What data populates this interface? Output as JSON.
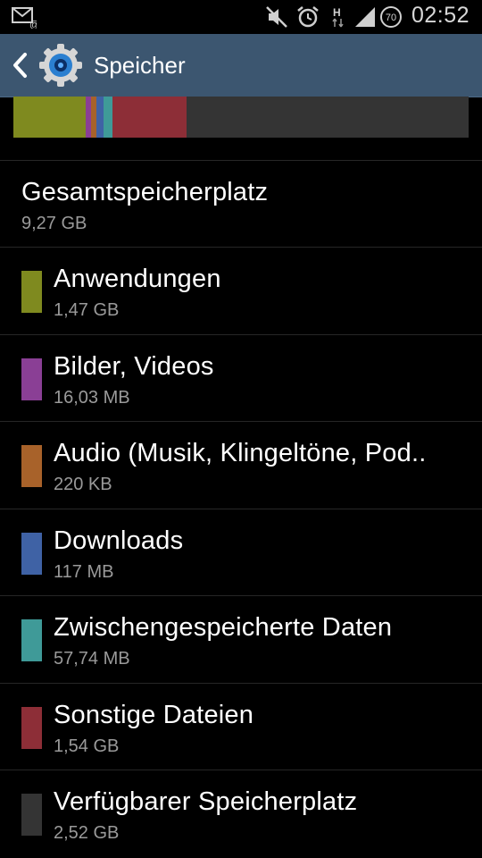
{
  "statusbar": {
    "time": "02:52",
    "battery_level": "70",
    "network_label": "H",
    "icons": [
      "email-notification-icon",
      "mute-icon",
      "alarm-icon",
      "network-h-icon",
      "signal-icon",
      "battery-icon"
    ]
  },
  "actionbar": {
    "title": "Speicher",
    "back_icon": "chevron-left-icon",
    "app_icon": "settings-gear-icon"
  },
  "total": {
    "label": "Gesamtspeicherplatz",
    "value": "9,27 GB"
  },
  "categories": [
    {
      "label": "Anwendungen",
      "size": "1,47 GB",
      "color": "#7f8a1f"
    },
    {
      "label": "Bilder, Videos",
      "size": "16,03 MB",
      "color": "#8a3f95"
    },
    {
      "label": "Audio (Musik, Klingeltöne, Pod..",
      "size": "220 KB",
      "color": "#a8622a"
    },
    {
      "label": "Downloads",
      "size": "117 MB",
      "color": "#3f62a5"
    },
    {
      "label": "Zwischengespeicherte Daten",
      "size": "57,74 MB",
      "color": "#3f9a98"
    },
    {
      "label": "Sonstige Dateien",
      "size": "1,54 GB",
      "color": "#8d2e37"
    },
    {
      "label": "Verfügbarer Speicherplatz",
      "size": "2,52 GB",
      "color": "#343434"
    }
  ],
  "usage_bar_fractions": [
    0.159,
    0.012,
    0.012,
    0.016,
    0.02,
    0.163,
    0.618
  ]
}
